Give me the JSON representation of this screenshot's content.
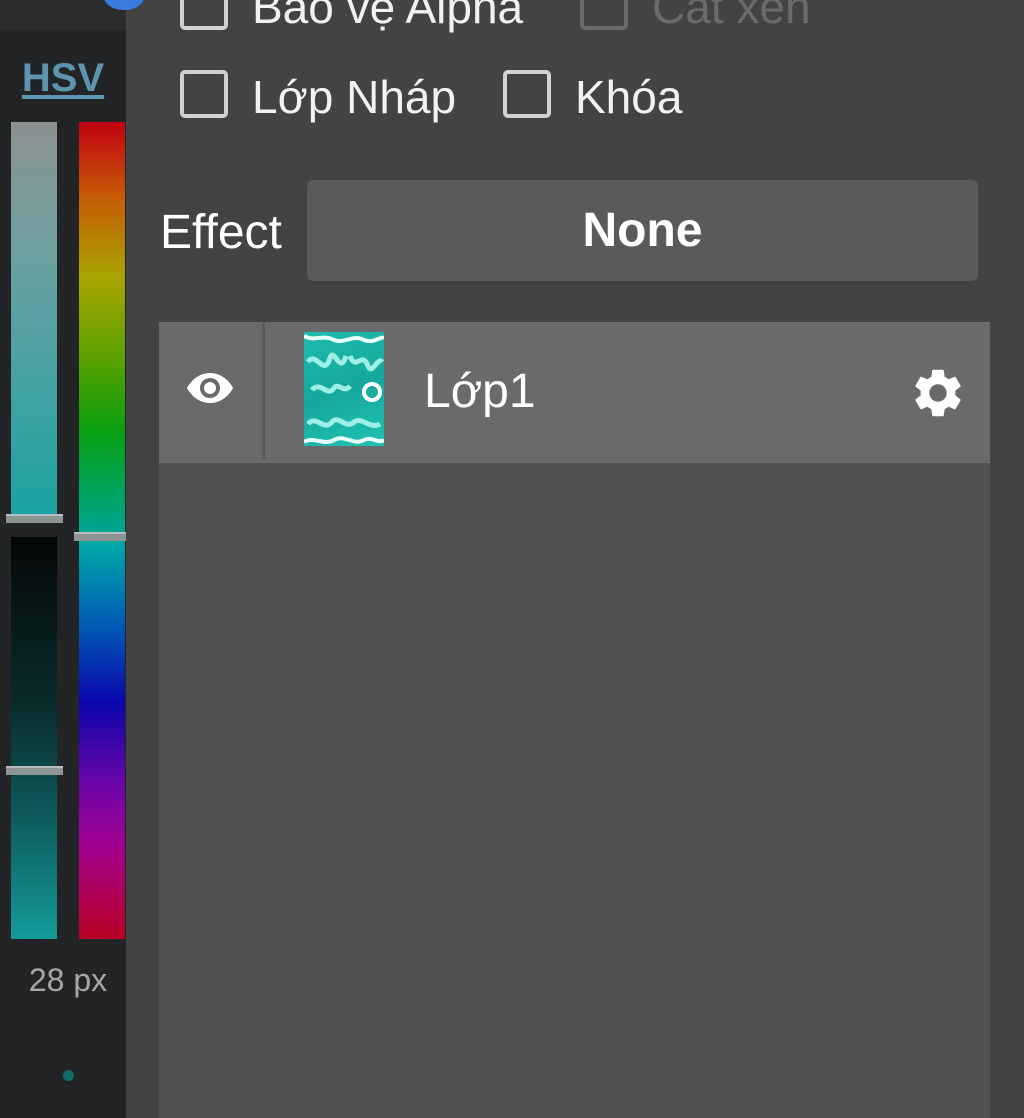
{
  "color_panel": {
    "mode_label": "HSV",
    "brush_size": "28 px",
    "saturation_level": 0.48,
    "value_level": 0.57,
    "hue_level": 0.5
  },
  "options": {
    "protect_alpha": {
      "label": "Bảo vệ Alpha",
      "checked": false
    },
    "clipping": {
      "label": "Cắt xén",
      "checked": false,
      "disabled": true
    },
    "draft_layer": {
      "label": "Lớp Nháp",
      "checked": false
    },
    "lock": {
      "label": "Khóa",
      "checked": false
    }
  },
  "effect": {
    "label": "Effect",
    "value": "None"
  },
  "layers": [
    {
      "name": "Lớp1",
      "visible": true,
      "thumbnail_text": "I'm so tired"
    }
  ],
  "colors": {
    "background": "#434343",
    "strip": "#232425",
    "layer_row": "#6a6a6a",
    "layers_panel": "#515151",
    "effect_button": "#5a5a5c",
    "hsv_link": "#5d95b1"
  },
  "icons": {
    "eye": "eye-icon",
    "gear": "gear-icon"
  }
}
